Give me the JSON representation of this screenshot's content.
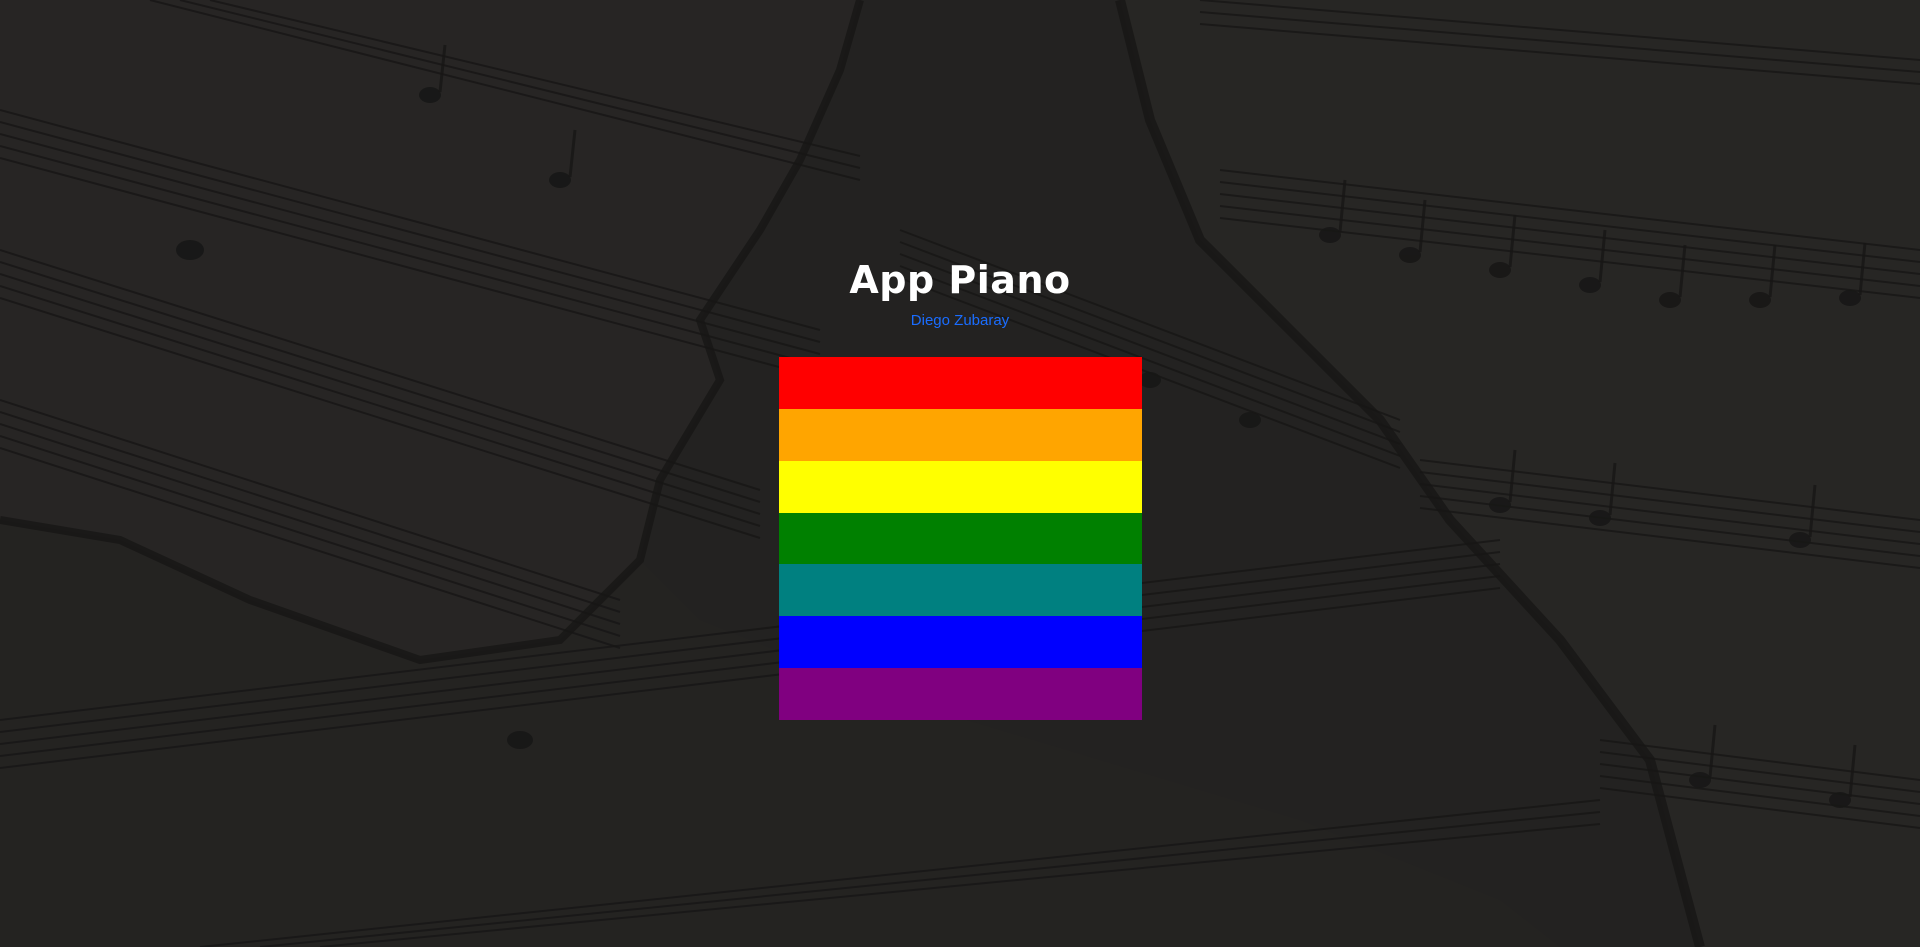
{
  "header": {
    "title": "App Piano",
    "author": "Diego Zubaray"
  },
  "piano": {
    "keys": [
      {
        "name": "key-red",
        "color": "#ff0000"
      },
      {
        "name": "key-orange",
        "color": "#ffa500"
      },
      {
        "name": "key-yellow",
        "color": "#ffff00"
      },
      {
        "name": "key-green",
        "color": "#008000"
      },
      {
        "name": "key-teal",
        "color": "#008080"
      },
      {
        "name": "key-blue",
        "color": "#0000ff"
      },
      {
        "name": "key-purple",
        "color": "#800080"
      }
    ]
  },
  "colors": {
    "background_overlay": "#2b2a29",
    "title": "#ffffff",
    "link": "#1a6dff"
  }
}
